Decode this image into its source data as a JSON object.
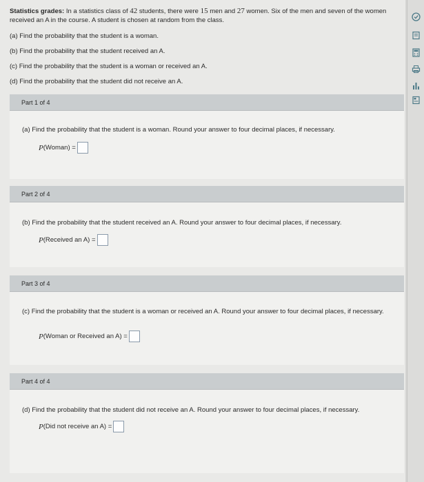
{
  "problem": {
    "lead": "Statistics grades:",
    "intro_1": "In a statistics class of",
    "total": "42",
    "intro_2": "students, there were",
    "men": "15",
    "intro_3": "men and",
    "women": "27",
    "intro_4": "women. Six of the men and seven of the women received an A in the course. A student is chosen at random from the class.",
    "items": [
      "(a) Find the probability that the student is a woman.",
      "(b) Find the probability that the student received an A.",
      "(c) Find the probability that the student is a woman or received an A.",
      "(d) Find the probability that the student did not receive an A."
    ]
  },
  "parts": [
    {
      "header": "Part 1 of 4",
      "question": "(a) Find the probability that the student is a woman. Round your answer to four decimal places, if necessary.",
      "p": "P",
      "arg": "(Woman) ="
    },
    {
      "header": "Part 2 of 4",
      "question": "(b) Find the probability that the student received an A. Round your answer to four decimal places, if necessary.",
      "p": "P",
      "arg": "(Received an A) ="
    },
    {
      "header": "Part 3 of 4",
      "question": "(c) Find the probability that the student is a woman or received an A. Round your answer to four decimal places, if necessary.",
      "p": "P",
      "arg": "(Woman or Received an A) ="
    },
    {
      "header": "Part 4 of 4",
      "question": "(d) Find the probability that the student did not receive an A. Round your answer to four decimal places, if necessary.",
      "p": "P",
      "arg": "(Did not receive an A) ="
    }
  ],
  "sidebar_icons": [
    "check-circle-icon",
    "book-icon",
    "calculator-icon",
    "print-icon",
    "chart-icon",
    "notes-icon"
  ],
  "colors": {
    "accent": "#4d7a88",
    "card_header": "#c9cdcf"
  }
}
